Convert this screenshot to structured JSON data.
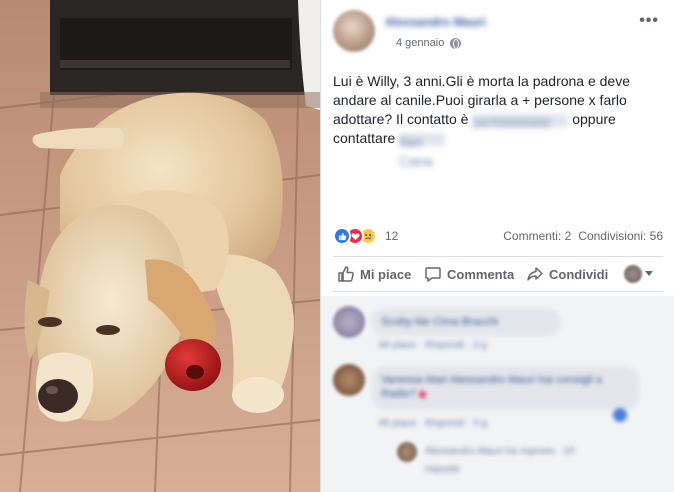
{
  "post": {
    "author_name": "Alessandro Mauri",
    "timestamp": "4 gennaio",
    "audience_icon": "globe-icon",
    "more_label": "•••",
    "text_part1": "Lui è Willy, 3 anni.Gli è morta la padrona e deve andare al canile.Puoi girarla a + persone x farlo adottare? Il contatto è ",
    "text_hidden_contact": "3470000000",
    "text_part2": " oppure contattare ",
    "text_hidden_name": "Ilari Cana"
  },
  "stats": {
    "reactions": [
      "like",
      "love",
      "sad"
    ],
    "reaction_count": "12",
    "comments_label": "Commenti: 2",
    "shares_label": "Condivisioni: 56"
  },
  "actions": {
    "like_label": "Mi piace",
    "comment_label": "Commenta",
    "share_label": "Condividi"
  },
  "comments": [
    {
      "author": "Scoby Ale Cima Bracchi",
      "text": "",
      "meta": "Mi piace · Rispondi · 3 g"
    },
    {
      "author": "Vanessa Mari",
      "text": "Alessandro Mauri hai consigli a Radio?",
      "meta": "Mi piace · Rispondi · 3 g",
      "reply": "Alessandro Mauri ha risposto · 10",
      "reply_sub": "risposte"
    }
  ],
  "colors": {
    "link_blue": "#365899",
    "text": "#1d2129",
    "muted": "#606770",
    "like_blue": "#2e78f0",
    "love_red": "#f0284a",
    "sad_yellow": "#f7c948"
  }
}
